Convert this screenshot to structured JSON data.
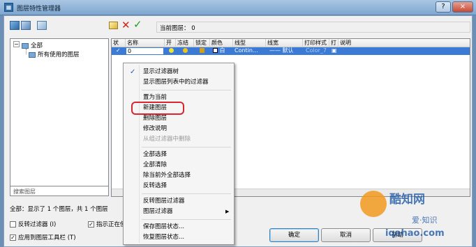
{
  "window": {
    "title": "图层特性管理器",
    "help_icon": "?",
    "close_icon": "×"
  },
  "toolbar": {
    "current_layer_label": "当前图层：",
    "current_layer_value": "0"
  },
  "tree": {
    "root": "全部",
    "child": "所有使用的图层"
  },
  "search": {
    "placeholder": "搜索图层"
  },
  "grid": {
    "columns": [
      "状",
      "名称",
      "开",
      "冻结",
      "锁定",
      "颜色",
      "线型",
      "线宽",
      "打印样式",
      "打",
      "说明"
    ],
    "row": {
      "name": "0",
      "color": "白",
      "linetype": "Contin...",
      "lineweight": "—— 默认",
      "plotstyle": "Color_7"
    },
    "colors": {
      "selected_row": "#3b7bd6",
      "bulb": "#f3e03a",
      "sun": "#f0c419",
      "lock": "#d4a017"
    }
  },
  "status": {
    "text": "全部：显示了 1 个图层，共 1 个图层"
  },
  "checkboxes": [
    {
      "label": "反转过滤器 (I)",
      "checked": false
    },
    {
      "label": "指示正在使",
      "checked": true
    },
    {
      "label": "应用到图层工具栏 (T)",
      "checked": true
    }
  ],
  "buttons": {
    "ok": "确定",
    "cancel": "取消",
    "help": "帮助"
  },
  "context_menu": {
    "items": [
      {
        "label": "显示过滤器树",
        "checked": true,
        "disabled": false
      },
      {
        "label": "显示图层列表中的过滤器",
        "checked": false,
        "disabled": false
      },
      {
        "label": "置为当前",
        "checked": false,
        "disabled": false
      },
      {
        "label": "新建图层",
        "checked": false,
        "disabled": false
      },
      {
        "label": "删除图层",
        "checked": false,
        "disabled": false
      },
      {
        "label": "修改说明",
        "checked": false,
        "disabled": false
      },
      {
        "label": "从组过滤器中删除",
        "checked": false,
        "disabled": true
      },
      {
        "label": "全部选择",
        "checked": false,
        "disabled": false
      },
      {
        "label": "全部清除",
        "checked": false,
        "disabled": false
      },
      {
        "label": "除当前外全部选择",
        "checked": false,
        "disabled": false
      },
      {
        "label": "反转选择",
        "checked": false,
        "disabled": false
      },
      {
        "label": "反转图层过滤器",
        "checked": false,
        "disabled": false
      },
      {
        "label": "图层过滤器",
        "checked": false,
        "disabled": false,
        "submenu": true
      },
      {
        "label": "保存图层状态...",
        "checked": false,
        "disabled": false
      },
      {
        "label": "恢复图层状态...",
        "checked": false,
        "disabled": false
      }
    ]
  },
  "watermark": {
    "line1": "酷知网",
    "line2": "爱·知识",
    "line3": "iqahao.com"
  }
}
